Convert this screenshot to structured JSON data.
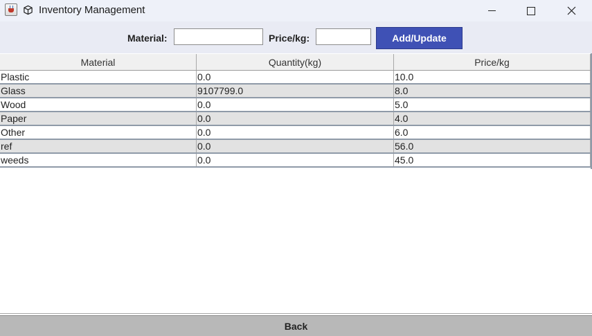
{
  "window": {
    "title": "Inventory Management"
  },
  "toolbar": {
    "material_label": "Material:",
    "material_value": "",
    "price_label": "Price/kg:",
    "price_value": "",
    "add_update_label": "Add/Update"
  },
  "table": {
    "columns": [
      "Material",
      "Quantity(kg)",
      "Price/kg"
    ],
    "rows": [
      [
        "Plastic",
        "0.0",
        "10.0"
      ],
      [
        "Glass",
        "9107799.0",
        "8.0"
      ],
      [
        "Wood",
        "0.0",
        "5.0"
      ],
      [
        "Paper",
        "0.0",
        "4.0"
      ],
      [
        "Other",
        "0.0",
        "6.0"
      ],
      [
        "ref",
        "0.0",
        "56.0"
      ],
      [
        "weeds",
        "0.0",
        "45.0"
      ]
    ]
  },
  "footer": {
    "back_label": "Back"
  },
  "colors": {
    "accent_button": "#3f51b5",
    "stripe_row": "#e2e2e2",
    "back_button": "#b8b8b8"
  },
  "icons": {
    "app": "java-cup-icon",
    "window": "cube-icon",
    "minimize": "minimize-icon",
    "maximize": "maximize-icon",
    "close": "close-icon"
  }
}
